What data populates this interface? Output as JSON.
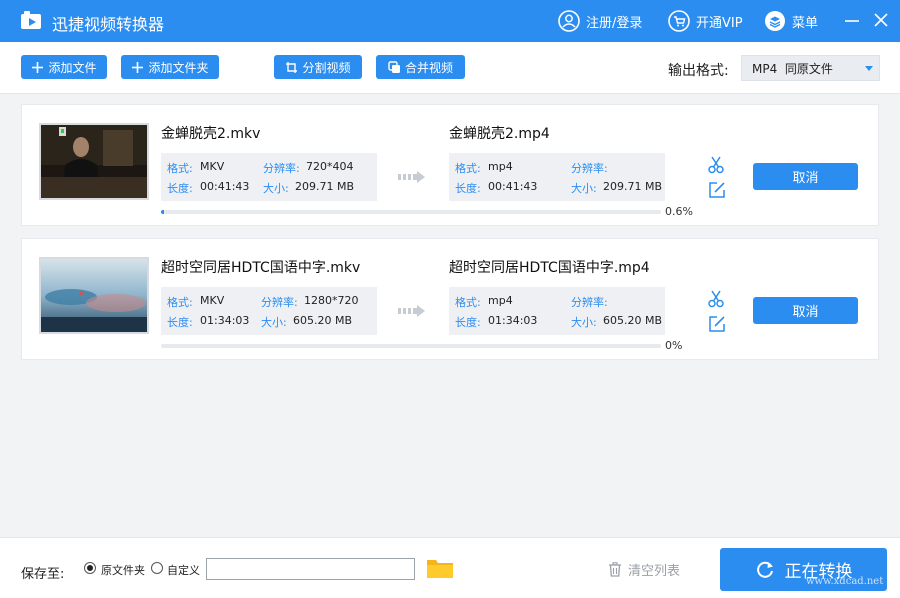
{
  "app": {
    "title": "迅捷视频转换器",
    "login_label": "注册/登录",
    "vip_label": "开通VIP",
    "menu_label": "菜单"
  },
  "toolbar": {
    "add_file_label": "添加文件",
    "add_folder_label": "添加文件夹",
    "split_label": "分割视频",
    "merge_label": "合并视频",
    "output_format_label": "输出格式:",
    "output_format_value": "MP4  同原文件"
  },
  "files": [
    {
      "input": {
        "name": "金蝉脱壳2.mkv",
        "format_label": "格式:",
        "format": "MKV",
        "resolution_label": "分辨率:",
        "resolution": "720*404",
        "duration_label": "长度:",
        "duration": "00:41:43",
        "size_label": "大小:",
        "size": "209.71 MB"
      },
      "output": {
        "name": "金蝉脱壳2.mp4",
        "format_label": "格式:",
        "format": "mp4",
        "resolution_label": "分辨率:",
        "resolution": "",
        "duration_label": "长度:",
        "duration": "00:41:43",
        "size_label": "大小:",
        "size": "209.71 MB"
      },
      "progress_pct": 0.6,
      "progress_text": "0.6%",
      "cancel_label": "取消"
    },
    {
      "input": {
        "name": "超时空同居HDTC国语中字.mkv",
        "format_label": "格式:",
        "format": "MKV",
        "resolution_label": "分辨率:",
        "resolution": "1280*720",
        "duration_label": "长度:",
        "duration": "01:34:03",
        "size_label": "大小:",
        "size": "605.20 MB"
      },
      "output": {
        "name": "超时空同居HDTC国语中字.mp4",
        "format_label": "格式:",
        "format": "mp4",
        "resolution_label": "分辨率:",
        "resolution": "",
        "duration_label": "长度:",
        "duration": "01:34:03",
        "size_label": "大小:",
        "size": "605.20 MB"
      },
      "progress_pct": 0,
      "progress_text": "0%",
      "cancel_label": "取消"
    }
  ],
  "footer": {
    "save_to_label": "保存至:",
    "option_original": "原文件夹",
    "option_custom": "自定义",
    "selected_option": "original",
    "custom_path_value": "",
    "clear_list_label": "清空列表",
    "convert_label": "正在转换"
  },
  "watermark": {
    "text": "www.xdcad.net"
  },
  "colors": {
    "primary": "#2c8df0",
    "info_bg": "#eef0f3",
    "page_bg": "#f2f3f5"
  },
  "icons": [
    "app-logo-icon",
    "user-icon",
    "cart-icon",
    "layers-icon",
    "minimize-icon",
    "close-icon",
    "plus-icon",
    "crop-icon",
    "merge-icon",
    "dropdown-caret-icon",
    "arrow-right-icon",
    "scissors-icon",
    "edit-icon",
    "folder-icon",
    "trash-icon",
    "refresh-icon"
  ]
}
